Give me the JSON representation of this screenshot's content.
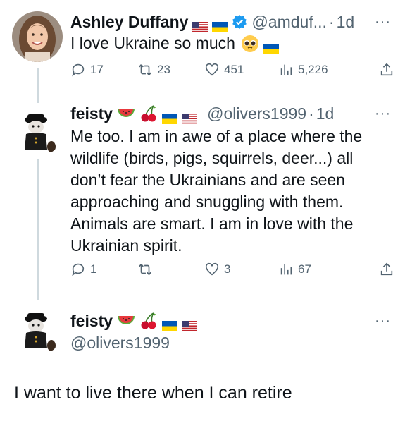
{
  "tweet1": {
    "name": "Ashley Duffany",
    "handle": "@amduf...",
    "separator": "·",
    "time": "1d",
    "text": "I love Ukraine so much",
    "stats": {
      "replies": "17",
      "retweets": "23",
      "likes": "451",
      "views": "5,226"
    }
  },
  "tweet2": {
    "name": "feisty",
    "handle": "@olivers1999",
    "separator": "·",
    "time": "1d",
    "text": "Me too.  I am in awe of a place where the wildlife (birds, pigs, squirrels, deer...) all don’t fear the Ukrainians and are seen approaching and snuggling with them. Animals are smart. I am in love with the Ukrainian spirit.",
    "stats": {
      "replies": "1",
      "retweets": "",
      "likes": "3",
      "views": "67"
    }
  },
  "main": {
    "name": "feisty",
    "handle": "@olivers1999",
    "text": "I want to live there when I can retire"
  },
  "more_label": "···",
  "colors": {
    "text": "#0f1419",
    "secondary": "#536471",
    "verified": "#1d9bf0",
    "thread": "#cfd9de"
  }
}
